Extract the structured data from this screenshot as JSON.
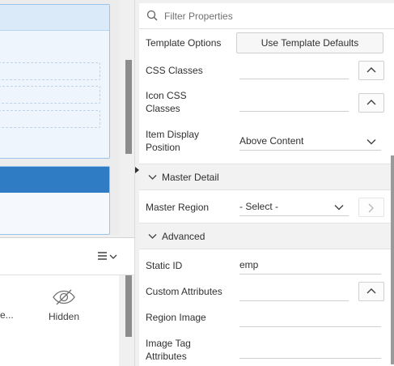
{
  "left_panel": {
    "gallery": {
      "truncated_item_label": "e...",
      "hidden_item_label": "Hidden"
    }
  },
  "properties": {
    "filter": {
      "placeholder": "Filter Properties"
    },
    "rows": {
      "template_options": {
        "label": "Template Options",
        "button_label": "Use Template Defaults"
      },
      "css_classes": {
        "label": "CSS Classes"
      },
      "icon_css_classes": {
        "label": "Icon CSS Classes"
      },
      "item_display_position": {
        "label": "Item Display Position",
        "value": "Above Content"
      },
      "master_region": {
        "label": "Master Region",
        "value": "- Select -"
      },
      "static_id": {
        "label": "Static ID",
        "value": "emp"
      },
      "custom_attributes": {
        "label": "Custom Attributes"
      },
      "region_image": {
        "label": "Region Image"
      },
      "image_tag_attributes": {
        "label": "Image Tag Attributes"
      }
    },
    "sections": {
      "master_detail": "Master Detail",
      "advanced": "Advanced"
    }
  },
  "icons": [
    "search-icon",
    "chevron-up-icon",
    "chevron-down-icon",
    "chevron-right-icon",
    "menu-icon",
    "eye-slash-icon",
    "splitter-arrow-icon"
  ],
  "colors": {
    "selected_region_header": "#2f7bc4",
    "region_border": "#9cc4ea",
    "section_background": "#f2f2f2"
  }
}
